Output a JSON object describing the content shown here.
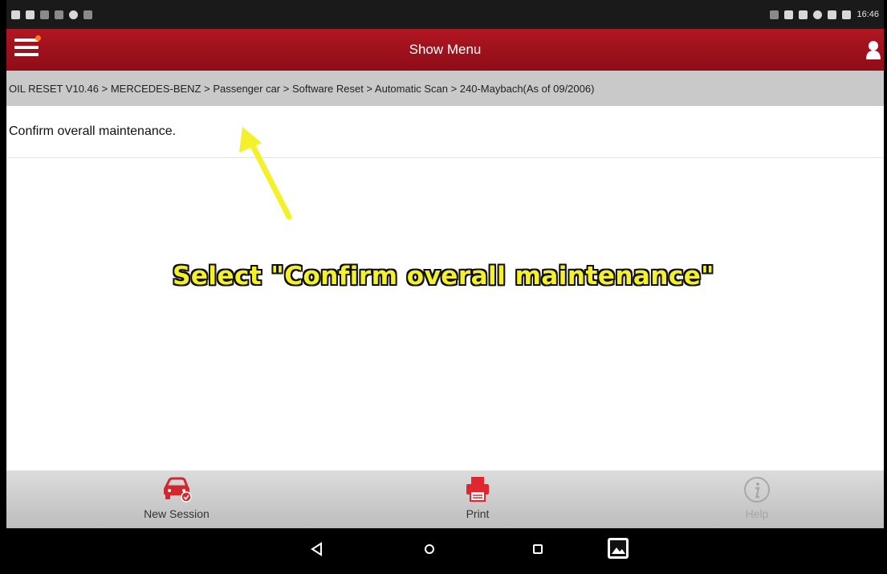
{
  "status_bar": {
    "time": "16:46"
  },
  "app_bar": {
    "title": "Show Menu",
    "menu_icon": "hamburger-icon",
    "user_icon": "user-icon",
    "accent_color": "#a3121d"
  },
  "breadcrumb": {
    "text": "OIL RESET V10.46 > MERCEDES-BENZ > Passenger car > Software Reset > Automatic Scan > 240-Maybach(As of 09/2006)"
  },
  "menu": {
    "items": [
      {
        "label": "Confirm overall maintenance."
      }
    ]
  },
  "overlay": {
    "caption": "Select \"Confirm overall maintenance\"",
    "color": "#f4f02a"
  },
  "bottom_bar": {
    "new_session_label": "New Session",
    "print_label": "Print",
    "help_label": "Help"
  }
}
